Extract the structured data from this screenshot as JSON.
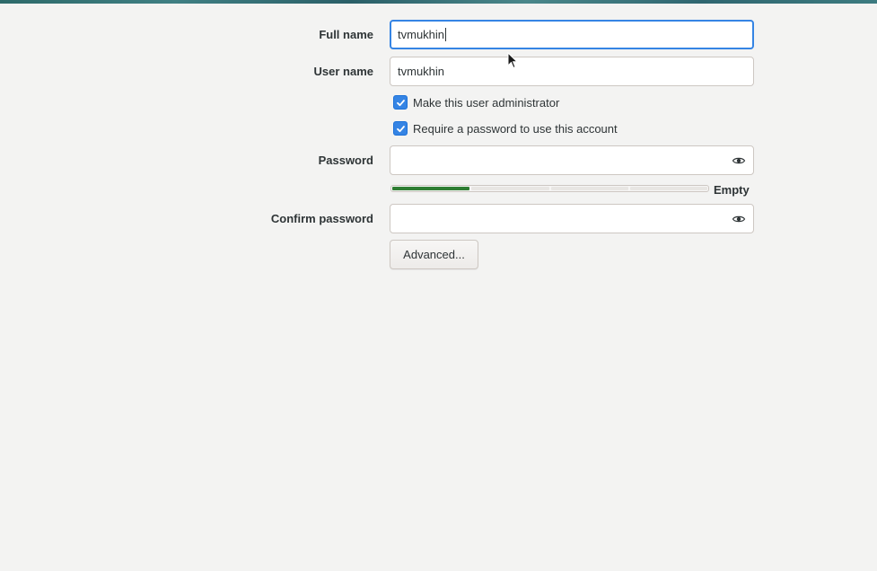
{
  "form": {
    "full_name": {
      "label": "Full name",
      "value": "tvmukhin"
    },
    "user_name": {
      "label": "User name",
      "value": "tvmukhin"
    },
    "make_admin": {
      "label": "Make this user administrator",
      "checked": true
    },
    "require_password": {
      "label": "Require a password to use this account",
      "checked": true
    },
    "password": {
      "label": "Password",
      "value": "",
      "icon": "eye-icon"
    },
    "password_strength": {
      "label": "Empty",
      "filled_segments": 1,
      "total_segments": 4
    },
    "confirm_password": {
      "label": "Confirm password",
      "value": "",
      "icon": "eye-icon"
    },
    "advanced_button": {
      "label": "Advanced..."
    }
  },
  "colors": {
    "accent": "#3584e4",
    "strength_fill": "#2e7d32",
    "background": "#f3f3f2"
  }
}
